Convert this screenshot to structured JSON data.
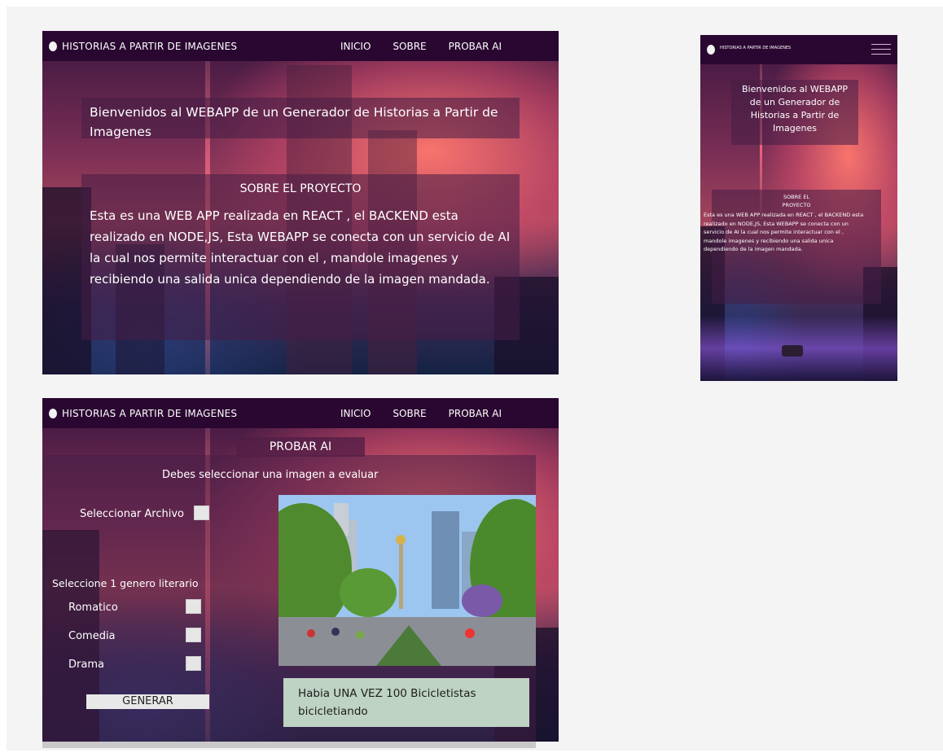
{
  "nav": {
    "brand": "HISTORIAS A PARTIR DE IMAGENES",
    "links": [
      "INICIO",
      "SOBRE",
      "PROBAR AI"
    ]
  },
  "home": {
    "hero_title": "Bienvenidos al WEBAPP de un Generador de Historias a Partir de Imagenes",
    "about_heading": "SOBRE EL PROYECTO",
    "about_text": "Esta es una WEB APP realizada en REACT , el BACKEND esta realizado en NODE,JS,  Esta WEBAPP se conecta con un servicio de AI la cual nos permite interactuar con el , mandole imagenes y recibiendo una salida unica dependiendo de la imagen mandada."
  },
  "mobile": {
    "brand": "HISTORIAS A PARTIR DE IMAGENES",
    "hero_title": "Bienvenidos al WEBAPP de un Generador de Historias a Partir de Imagenes",
    "about_heading": "SOBRE EL PROYECTO",
    "about_text": "Esta es una WEB APP realizada en REACT , el BACKEND esta realizado en NODE,JS,  Esta WEBAPP se conecta con un servicio de AI la cual nos permite interactuar con el , mandole imagenes y recibiendo una salida unica dependiendo de la imagen mandada."
  },
  "ai": {
    "title": "PROBAR AI",
    "instruction": "Debes seleccionar una imagen a evaluar",
    "select_file_label": "Seleccionar Archivo",
    "genre_prompt": "Seleccione 1 genero literario",
    "genres": [
      "Romatico",
      "Comedia",
      "Drama"
    ],
    "generate_label": "GENERAR",
    "result_text": "Habia UNA VEZ 100 Bicicletistas bicicletiando"
  }
}
